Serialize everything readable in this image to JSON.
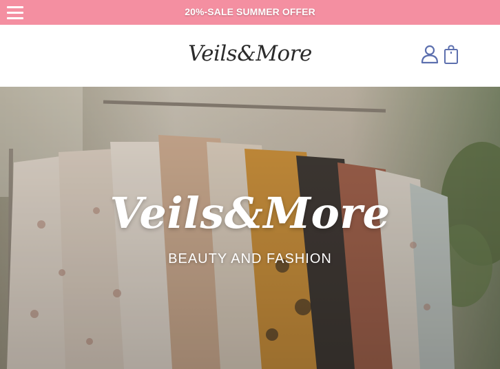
{
  "promo": {
    "text": "20%-SALE SUMMER OFFER",
    "background_color": "#f48fa1"
  },
  "header": {
    "logo_text": "Veils&More",
    "icons": [
      "menu-icon",
      "user-icon",
      "shopping-bag-icon"
    ],
    "icon_color": "#5c6fae"
  },
  "hero": {
    "title": "Veils&More",
    "subtitle": "BEAUTY AND FASHION"
  }
}
